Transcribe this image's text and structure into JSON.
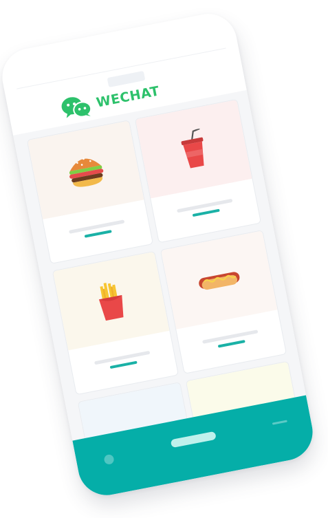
{
  "app": {
    "brand_name": "WECHAT",
    "brand_icon": "wechat-chat-bubbles-icon"
  },
  "products": [
    {
      "icon": "burger-icon",
      "bg": "#faf4ef"
    },
    {
      "icon": "soda-cup-icon",
      "bg": "#fcefef"
    },
    {
      "icon": "french-fries-icon",
      "bg": "#fbf7ec"
    },
    {
      "icon": "hotdog-icon",
      "bg": "#fcf6f3"
    },
    {
      "icon": "",
      "bg": "#f0f6fb"
    },
    {
      "icon": "",
      "bg": "#fbfbea"
    }
  ],
  "colors": {
    "brand": "#2dc16b",
    "accent": "#05aea8",
    "home_button": "#bff1ec"
  }
}
